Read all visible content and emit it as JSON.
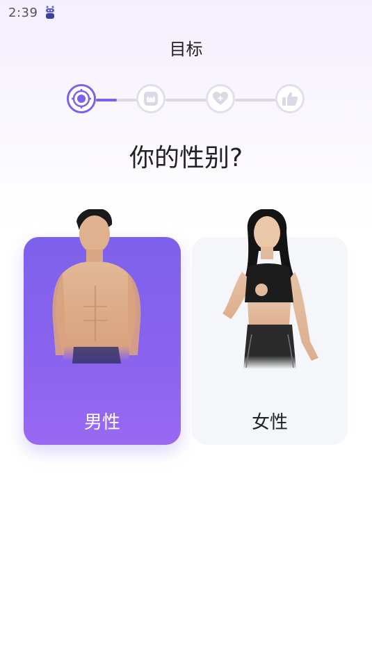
{
  "status_bar": {
    "time": "2:39",
    "app_icon": "android-robot-icon"
  },
  "header": {
    "title": "目标"
  },
  "stepper": {
    "steps": [
      {
        "icon": "target-icon",
        "state": "active"
      },
      {
        "icon": "scale-icon",
        "state": "inactive"
      },
      {
        "icon": "heart-plus-icon",
        "state": "inactive"
      },
      {
        "icon": "thumbs-up-icon",
        "state": "inactive"
      }
    ],
    "accent_color": "#7d61ea"
  },
  "question": "你的性别?",
  "options": [
    {
      "label": "男性",
      "selected": true,
      "image": "male-figure-photo"
    },
    {
      "label": "女性",
      "selected": false,
      "image": "female-figure-photo"
    }
  ]
}
